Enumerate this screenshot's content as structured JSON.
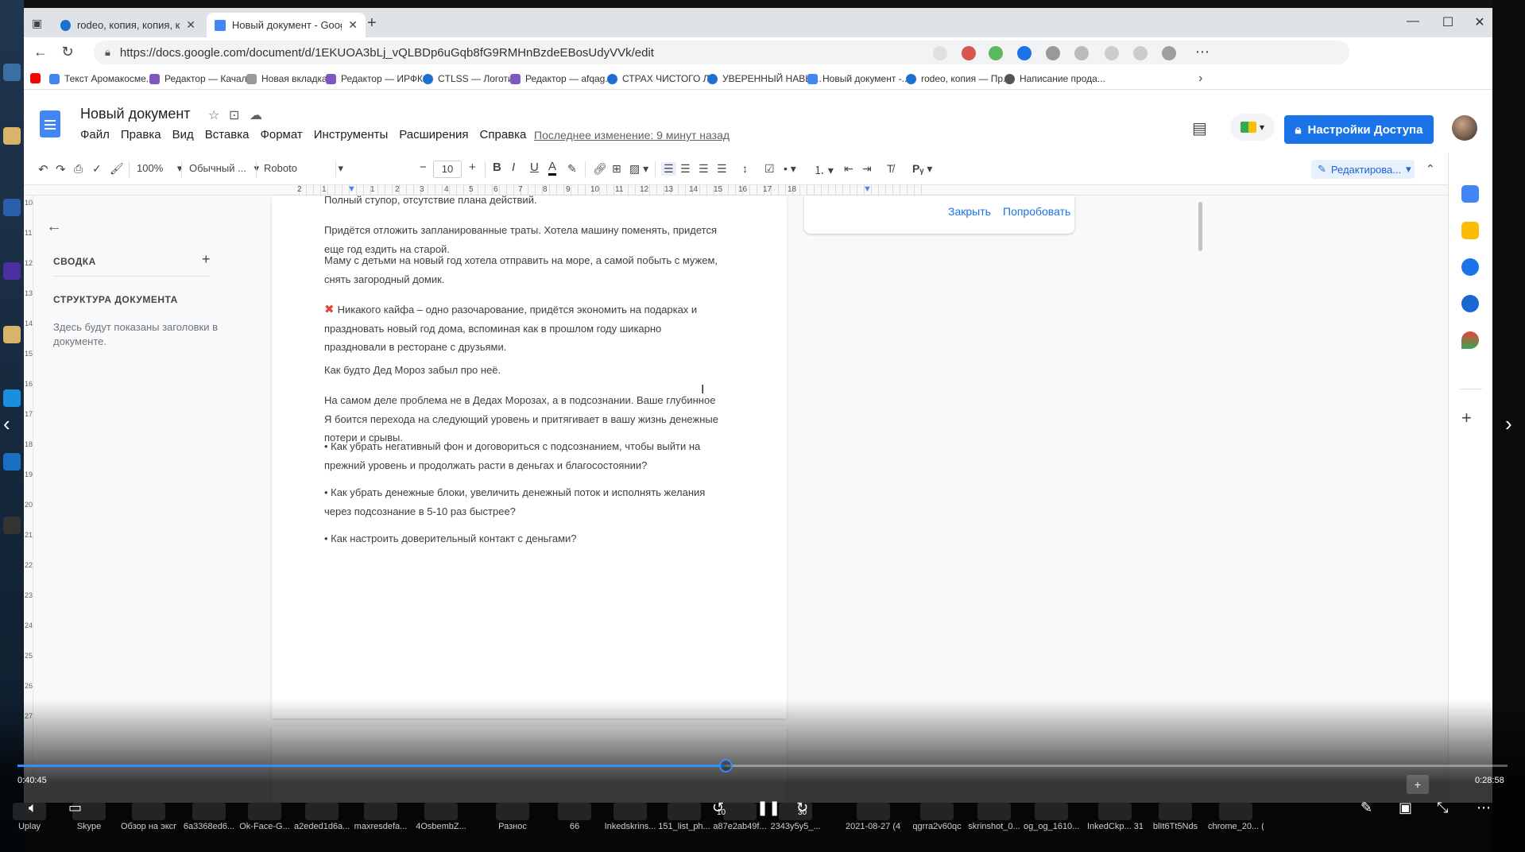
{
  "browser": {
    "tabs": [
      {
        "title": "rodeo, копия, копия, копия, коп",
        "active": false
      },
      {
        "title": "Новый документ - Google Доку",
        "active": true
      }
    ],
    "new_tab": "+",
    "url": "https://docs.google.com/document/d/1EKUOA3bLj_vQLBDp6uGqb8fG9RMHnBzdeEBosUdyVVk/edit",
    "bookmarks": [
      "Текст Аромакосме...",
      "Редактор — Качал...",
      "Новая вкладка",
      "Редактор — ИРФК...",
      "CTLSS — Логотип",
      "Редактор — afqag...",
      "СТРАХ ЧИСТОГО Л...",
      "УВЕРЕННЫЙ НАВЫ...",
      "Новый документ -...",
      "rodeo, копия — Пр...",
      "Написание прода..."
    ]
  },
  "docs": {
    "title": "Новый документ",
    "menu": [
      "Файл",
      "Правка",
      "Вид",
      "Вставка",
      "Формат",
      "Инструменты",
      "Расширения",
      "Справка"
    ],
    "last_edit": "Последнее изменение: 9 минут назад",
    "share_label": "Настройки Доступа",
    "toolbar": {
      "zoom": "100%",
      "style": "Обычный ...",
      "font": "Roboto",
      "font_size": "10",
      "minus": "−",
      "plus": "+",
      "bold": "B",
      "italic": "I",
      "underline": "U",
      "text_color": "A",
      "edit_mode": "Редактирова..."
    },
    "ruler_numbers": [
      "2",
      "1",
      "1",
      "2",
      "3",
      "4",
      "5",
      "6",
      "7",
      "8",
      "9",
      "10",
      "11",
      "12",
      "13",
      "14",
      "15",
      "16",
      "17",
      "18"
    ],
    "vruler_numbers": [
      "10",
      "11",
      "12",
      "13",
      "14",
      "15",
      "16",
      "17",
      "18",
      "19",
      "20",
      "21",
      "22",
      "23",
      "24",
      "25",
      "26",
      "27"
    ],
    "outline": {
      "summary": "СВОДКА",
      "structure": "СТРУКТУРА ДОКУМЕНТА",
      "hint": "Здесь будут показаны заголовки в документе."
    },
    "suggestion": {
      "close": "Закрыть",
      "try": "Попробовать"
    },
    "paragraphs": [
      "Полный ступор, отсутствие плана действий.",
      "Придётся отложить запланированные траты. Хотела машину поменять, придется еще год ездить на старой.",
      "Маму с детьми на новый год хотела отправить на море, а самой побыть с мужем, снять загородный домик.",
      "Никакого кайфа – одно разочарование, придётся экономить на подарках и праздновать новый год дома, вспоминая как в прошлом году шикарно праздновали в ресторане с друзьями.",
      "Как будто Дед Мороз забыл про неё.",
      "На самом деле проблема не в Дедах Морозах, а в подсознании. Ваше глубинное Я боится перехода на следующий уровень и притягивает в вашу жизнь денежные потери и срывы.",
      "• Как убрать негативный фон и договориться с подсознанием, чтобы выйти на прежний уровень и продолжать расти в деньгах и благосостоянии?",
      "• Как убрать денежные блоки, увеличить денежный поток и исполнять желания через подсознание в 5-10 раз быстрее?",
      "• Как настроить доверительный контакт с деньгами?"
    ]
  },
  "player": {
    "elapsed": "0:40:45",
    "remaining": "0:28:58",
    "progress": 0.475,
    "skip_back": "10",
    "skip_forward": "30",
    "accent": "#2f8fff"
  },
  "taskbar": [
    "Uplay",
    "Skype",
    "Обзор на экспресс-...",
    "6a3368ed6...",
    "Ok-Face-G...",
    "a2eded1d6a...",
    "maxresdefa...",
    "4OsbembZ...",
    "Разнос",
    "66",
    "Inkedskrins...",
    "151_list_ph...",
    "a87e2ab49f...",
    "2343y5y5_...",
    "2021-08-27 (4)_LI",
    "qgrra2v60qc",
    "skrinshot_0...",
    "og_og_1610...",
    "InkedCkp... 31-10-202...",
    "blIt6Tt5Nds",
    "chrome_20... (1)"
  ],
  "colors": {
    "share": "#1a73e8",
    "docs_blue": "#4285f4",
    "x_mark": "#e0463a"
  }
}
